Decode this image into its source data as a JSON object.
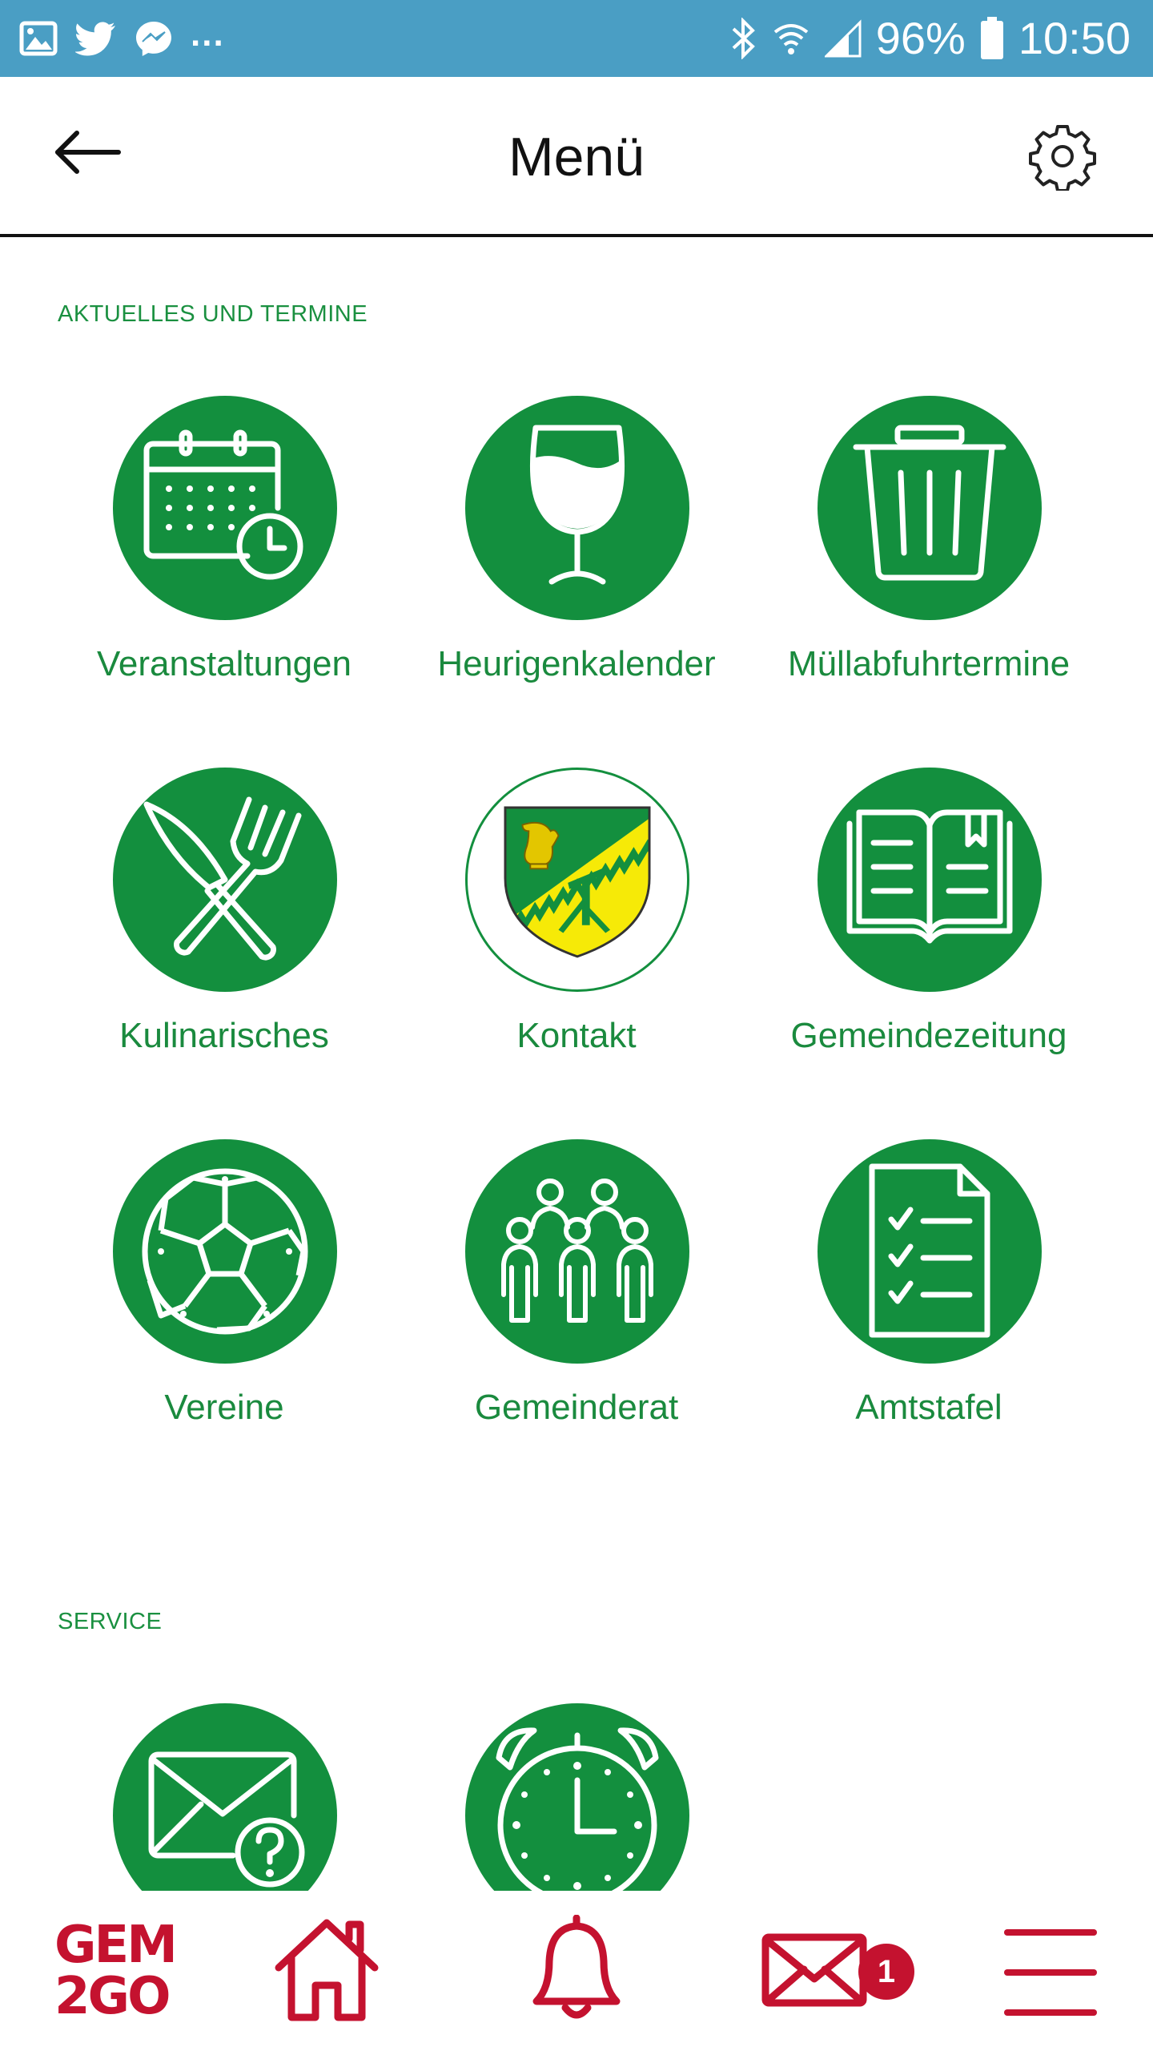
{
  "status_bar": {
    "battery": "96%",
    "time": "10:50",
    "overflow": "..."
  },
  "header": {
    "title": "Menü",
    "back_icon": "arrow-left-icon",
    "settings_icon": "gear-icon"
  },
  "sections": [
    {
      "title": "AKTUELLES UND TERMINE",
      "items": [
        {
          "label": "Veranstaltungen",
          "icon": "calendar-clock-icon"
        },
        {
          "label": "Heurigenkalender",
          "icon": "wine-glass-icon"
        },
        {
          "label": "Müllabfuhrtermine",
          "icon": "trash-bin-icon"
        },
        {
          "label": "Kulinarisches",
          "icon": "knife-fork-icon"
        },
        {
          "label": "Kontakt",
          "icon": "coat-of-arms-icon"
        },
        {
          "label": "Gemeindezeitung",
          "icon": "open-book-icon"
        },
        {
          "label": "Vereine",
          "icon": "soccer-ball-icon"
        },
        {
          "label": "Gemeinderat",
          "icon": "people-group-icon"
        },
        {
          "label": "Amtstafel",
          "icon": "checklist-icon"
        }
      ]
    },
    {
      "title": "SERVICE",
      "items": [
        {
          "label": "",
          "icon": "mail-question-icon"
        },
        {
          "label": "",
          "icon": "alarm-clock-icon"
        }
      ]
    }
  ],
  "bottom_nav": {
    "logo_line1": "GEM",
    "logo_line2": "2GO",
    "items": [
      "home-icon",
      "bell-icon",
      "mail-icon",
      "menu-icon"
    ],
    "mail_badge": "1"
  },
  "colors": {
    "status_bar": "#4a9ec4",
    "primary_green": "#138f3e",
    "label_green": "#1a8a3e",
    "brand_red": "#c4122f"
  }
}
